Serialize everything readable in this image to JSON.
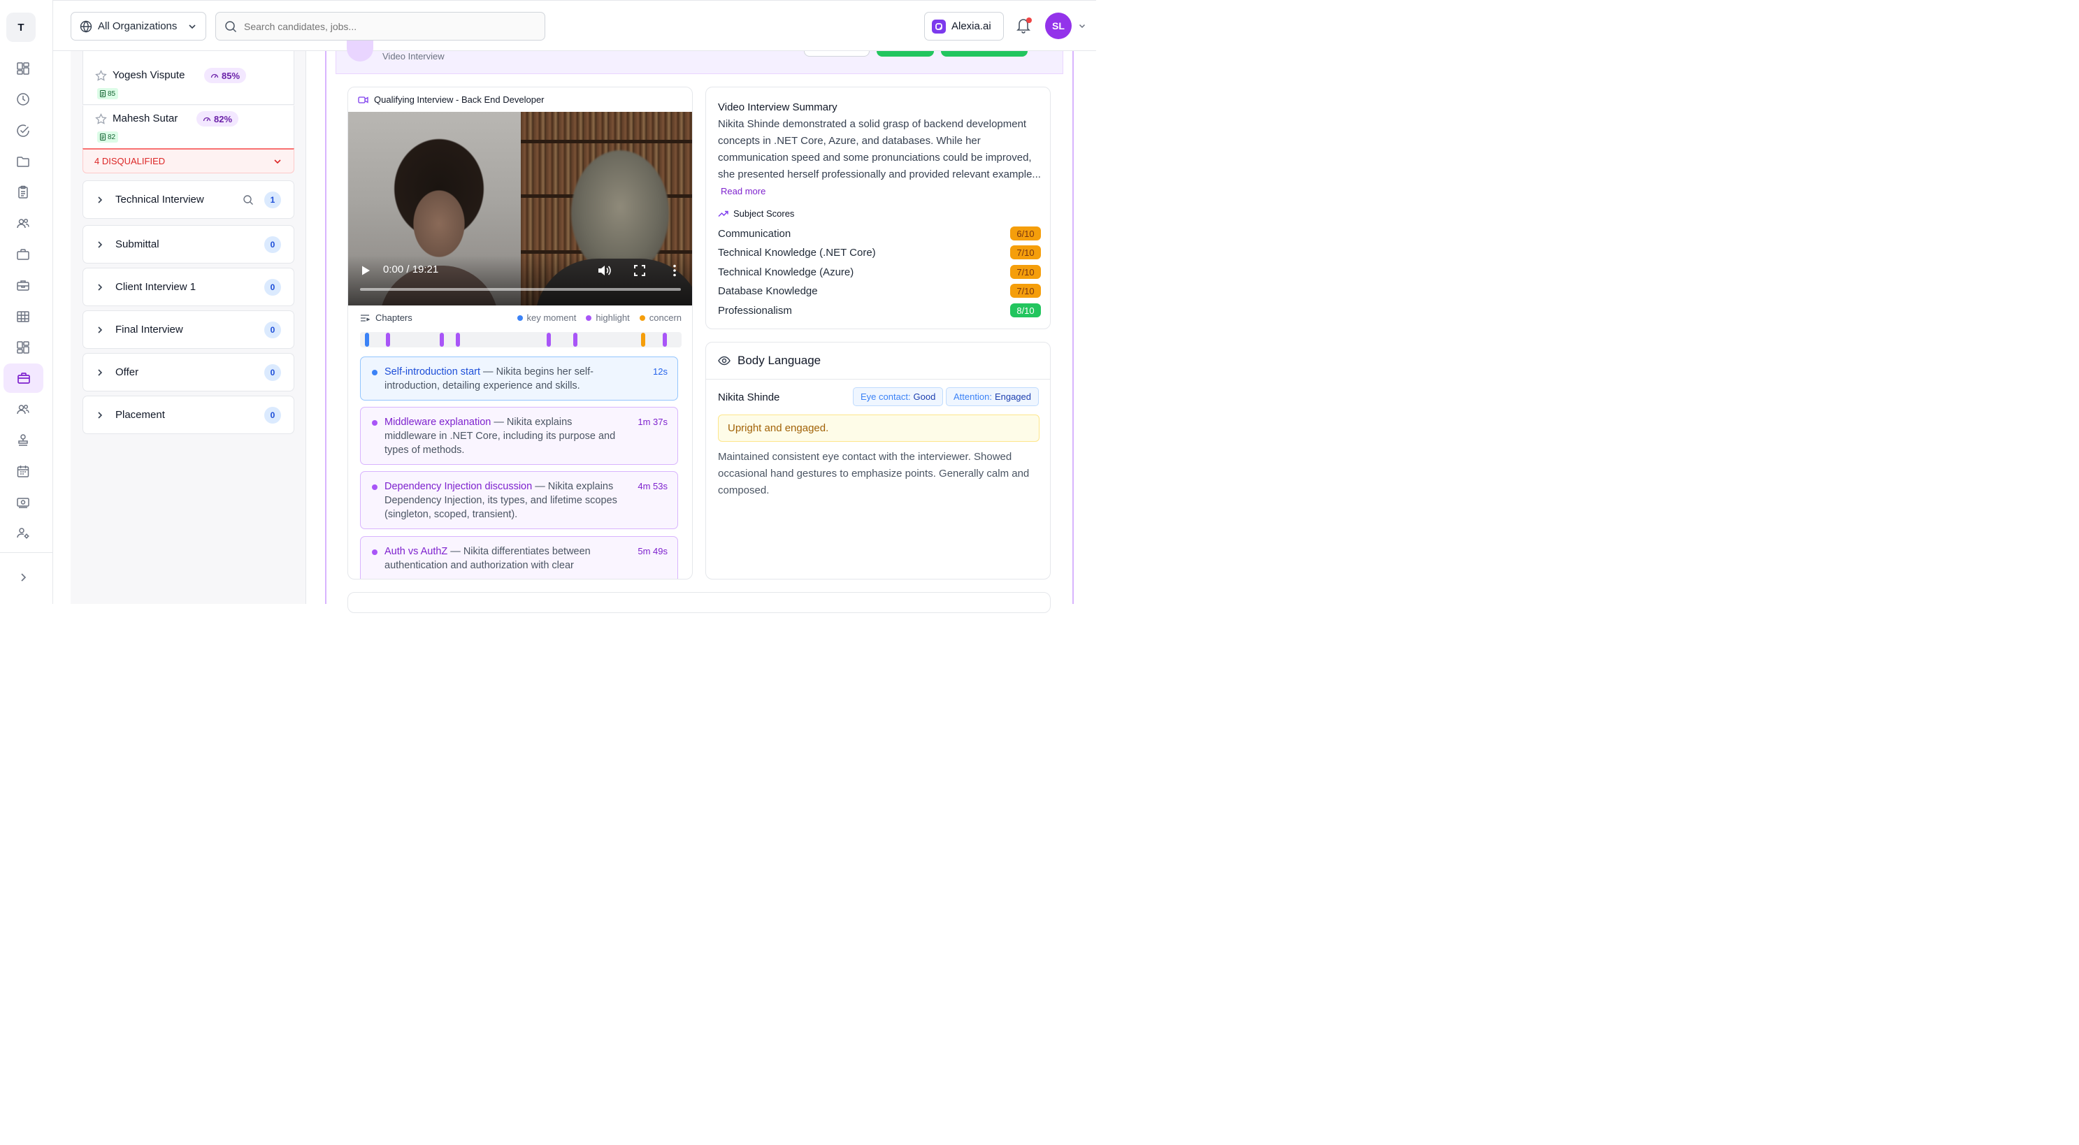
{
  "rail": {
    "logo_letter": "T",
    "icons": [
      "dashboard-icon",
      "clock-icon",
      "check-circle-icon",
      "folder-icon",
      "clipboard-icon",
      "users-icon",
      "briefcase-icon",
      "toolbox-icon",
      "grid-icon",
      "layout-icon",
      "jobs-icon",
      "team-icon",
      "stamp-icon",
      "calendar-icon",
      "payment-icon",
      "user-settings-icon"
    ],
    "active_icon": "jobs-icon",
    "expand_icon": "chevron-right-icon"
  },
  "topbar": {
    "org_label": "All Organizations",
    "search_placeholder": "Search candidates, jobs...",
    "alexia_label": "Alexia.ai",
    "avatar_initials": "SL"
  },
  "pipeline": {
    "candidates": [
      {
        "name": "Yogesh Vispute",
        "score": "85%",
        "doc_count": "85"
      },
      {
        "name": "Mahesh Sutar",
        "score": "82%",
        "doc_count": "82"
      }
    ],
    "disqualified_label": "4 DISQUALIFIED",
    "stages": [
      {
        "label": "Technical Interview",
        "count": "1",
        "has_search": true
      },
      {
        "label": "Submittal",
        "count": "0"
      },
      {
        "label": "Client Interview 1",
        "count": "0"
      },
      {
        "label": "Final Interview",
        "count": "0"
      },
      {
        "label": "Offer",
        "count": "0"
      },
      {
        "label": "Placement",
        "count": "0"
      }
    ]
  },
  "main": {
    "header_subtitle": "Video Interview",
    "colors": {
      "accent": "#7e22ce",
      "green": "#16a34a",
      "orange": "#f59e0b",
      "blue": "#3b82f6"
    }
  },
  "video": {
    "title": "Qualifying Interview - Back End Developer",
    "time": "0:00 / 19:21",
    "chapters_label": "Chapters",
    "legend": {
      "key": "key moment",
      "highlight": "highlight",
      "concern": "concern"
    },
    "timeline_marks": [
      {
        "type": "key",
        "at": 0.016
      },
      {
        "type": "highlight",
        "at": 0.082
      },
      {
        "type": "highlight",
        "at": 0.252
      },
      {
        "type": "highlight",
        "at": 0.302
      },
      {
        "type": "highlight",
        "at": 0.588
      },
      {
        "type": "highlight",
        "at": 0.671
      },
      {
        "type": "concern",
        "at": 0.885
      },
      {
        "type": "highlight",
        "at": 0.953
      }
    ],
    "chapters": [
      {
        "kind": "key",
        "title": "Self-introduction start",
        "body": " — Nikita begins her self-introduction, detailing experience and skills.",
        "time": "12s"
      },
      {
        "kind": "highlight",
        "title": "Middleware explanation",
        "body": " — Nikita explains middleware in .NET Core, including its purpose and types of methods.",
        "time": "1m 37s"
      },
      {
        "kind": "highlight",
        "title": "Dependency Injection discussion",
        "body": " — Nikita explains Dependency Injection, its types, and lifetime scopes (singleton, scoped, transient).",
        "time": "4m 53s"
      },
      {
        "kind": "highlight",
        "title": "Auth vs AuthZ",
        "body": " — Nikita differentiates between authentication and authorization with clear",
        "time": "5m 49s"
      }
    ]
  },
  "summary": {
    "title": "Video Interview Summary",
    "text": "Nikita Shinde demonstrated a solid grasp of backend development concepts in .NET Core, Azure, and databases. While her communication speed and some pronunciations could be improved, she presented herself professionally and provided relevant example...",
    "read_more": "Read more",
    "scores_label": "Subject Scores",
    "scores": [
      {
        "subject": "Communication",
        "score": "6/10",
        "level": "mid"
      },
      {
        "subject": "Technical Knowledge (.NET Core)",
        "score": "7/10",
        "level": "mid"
      },
      {
        "subject": "Technical Knowledge (Azure)",
        "score": "7/10",
        "level": "mid"
      },
      {
        "subject": "Database Knowledge",
        "score": "7/10",
        "level": "mid"
      },
      {
        "subject": "Professionalism",
        "score": "8/10",
        "level": "high"
      }
    ]
  },
  "body_language": {
    "title": "Body Language",
    "candidate": "Nikita Shinde",
    "eye_contact_label": "Eye contact:",
    "eye_contact_value": "Good",
    "attention_label": "Attention:",
    "attention_value": "Engaged",
    "note": "Upright and engaged.",
    "description": "Maintained consistent eye contact with the interviewer. Showed occasional hand gestures to emphasize points. Generally calm and composed."
  }
}
